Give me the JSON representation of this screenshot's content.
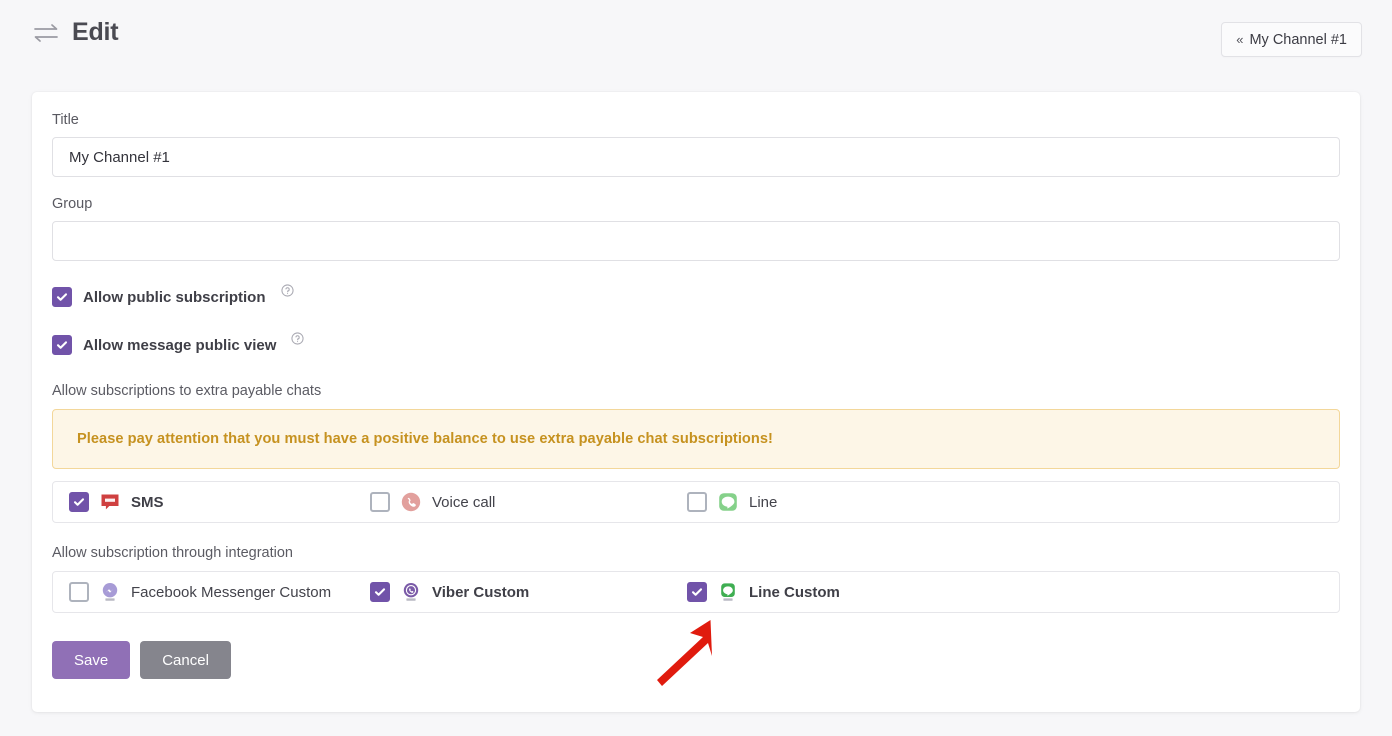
{
  "header": {
    "icon": "swap-arrows-icon",
    "title": "Edit",
    "back_button": {
      "chevron": "«",
      "label": "My Channel #1"
    }
  },
  "form": {
    "title_field": {
      "label": "Title",
      "value": "My Channel #1",
      "placeholder": ""
    },
    "group_field": {
      "label": "Group",
      "value": "",
      "placeholder": ""
    },
    "toggles": [
      {
        "label": "Allow public subscription",
        "checked": true,
        "help": "?"
      },
      {
        "label": "Allow message public view",
        "checked": true,
        "help": "?"
      }
    ],
    "payable_section": {
      "label": "Allow subscriptions to extra payable chats",
      "warning": "Please pay attention that you must have a positive balance to use extra payable chat subscriptions!",
      "options": [
        {
          "label": "SMS",
          "checked": true,
          "icon": "sms-icon"
        },
        {
          "label": "Voice call",
          "checked": false,
          "icon": "voice-call-icon"
        },
        {
          "label": "Line",
          "checked": false,
          "icon": "line-icon"
        }
      ]
    },
    "integration_section": {
      "label": "Allow subscription through integration",
      "options": [
        {
          "label": "Facebook Messenger Custom",
          "checked": false,
          "icon": "facebook-messenger-custom-icon"
        },
        {
          "label": "Viber Custom",
          "checked": true,
          "icon": "viber-custom-icon"
        },
        {
          "label": "Line Custom",
          "checked": true,
          "icon": "line-custom-icon"
        }
      ]
    },
    "buttons": {
      "save": "Save",
      "cancel": "Cancel"
    }
  },
  "annotation": {
    "type": "arrow",
    "color": "#e01b0e",
    "points_to": "line-custom-checkbox"
  },
  "colors": {
    "accent_purple": "#7153a9",
    "save_purple": "#9070b6",
    "cancel_gray": "#85858d",
    "warning_bg": "#fdf6e7",
    "warning_border": "#f3d79a",
    "warning_text": "#c69220",
    "page_bg": "#f7f7f9"
  }
}
